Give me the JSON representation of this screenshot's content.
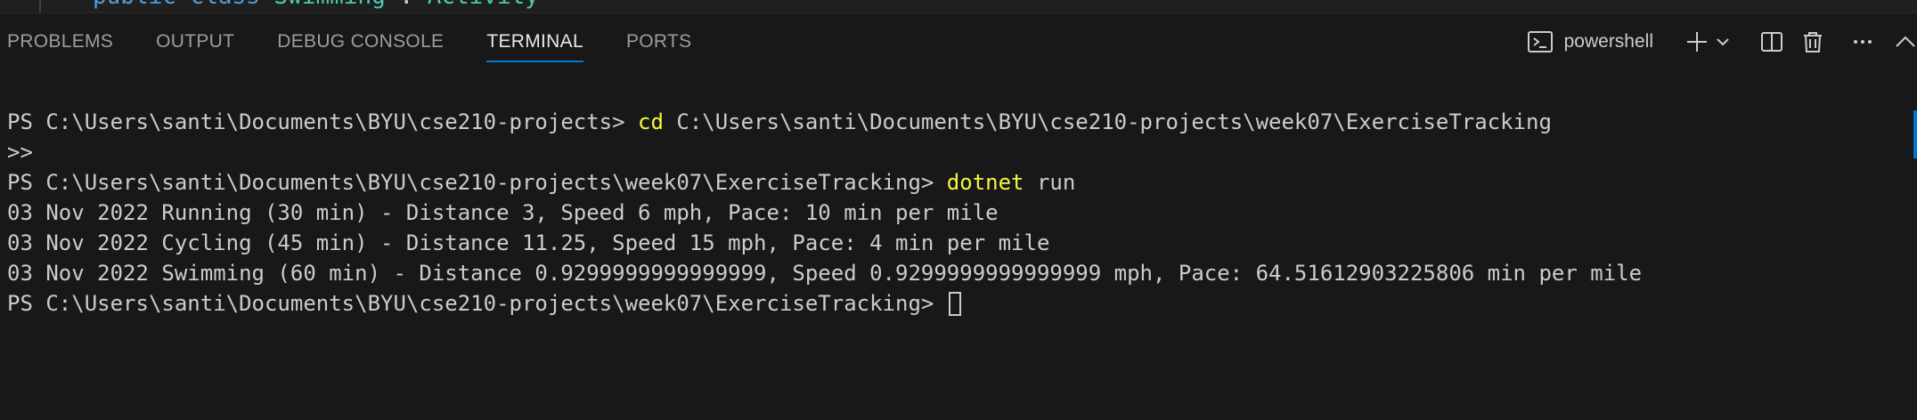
{
  "editor": {
    "code_keyword": "public class ",
    "code_class": "Swimming",
    "code_rest": " : ",
    "code_base": "Activity"
  },
  "panel": {
    "tabs": [
      {
        "label": "PROBLEMS"
      },
      {
        "label": "OUTPUT"
      },
      {
        "label": "DEBUG CONSOLE"
      },
      {
        "label": "TERMINAL"
      },
      {
        "label": "PORTS"
      }
    ],
    "active_tab": "TERMINAL",
    "shell_label": "powershell",
    "icons": {
      "shell": "terminal-powershell-icon",
      "new_terminal": "plus-icon",
      "dropdown": "chevron-down-icon",
      "split": "split-terminal-icon",
      "kill": "trash-icon",
      "more": "ellipsis-icon",
      "collapse": "chevron-up-icon"
    }
  },
  "terminal": {
    "line1_prompt": "PS C:\\Users\\santi\\Documents\\BYU\\cse210-projects> ",
    "line1_cmd": "cd",
    "line1_args": " C:\\Users\\santi\\Documents\\BYU\\cse210-projects\\week07\\ExerciseTracking",
    "line2": ">>",
    "line3_prompt": "PS C:\\Users\\santi\\Documents\\BYU\\cse210-projects\\week07\\ExerciseTracking> ",
    "line3_cmd": "dotnet",
    "line3_args": " run",
    "output": [
      "03 Nov 2022 Running (30 min) - Distance 3, Speed 6 mph, Pace: 10 min per mile",
      "03 Nov 2022 Cycling (45 min) - Distance 11.25, Speed 15 mph, Pace: 4 min per mile",
      "03 Nov 2022 Swimming (60 min) - Distance 0.9299999999999999, Speed 0.9299999999999999 mph, Pace: 64.51612903225806 min per mile"
    ],
    "last_prompt": "PS C:\\Users\\santi\\Documents\\BYU\\cse210-projects\\week07\\ExerciseTracking> "
  },
  "colors": {
    "background": "#181818",
    "accent": "#0078d4",
    "command_highlight": "#f5f543",
    "text": "#cccccc"
  }
}
